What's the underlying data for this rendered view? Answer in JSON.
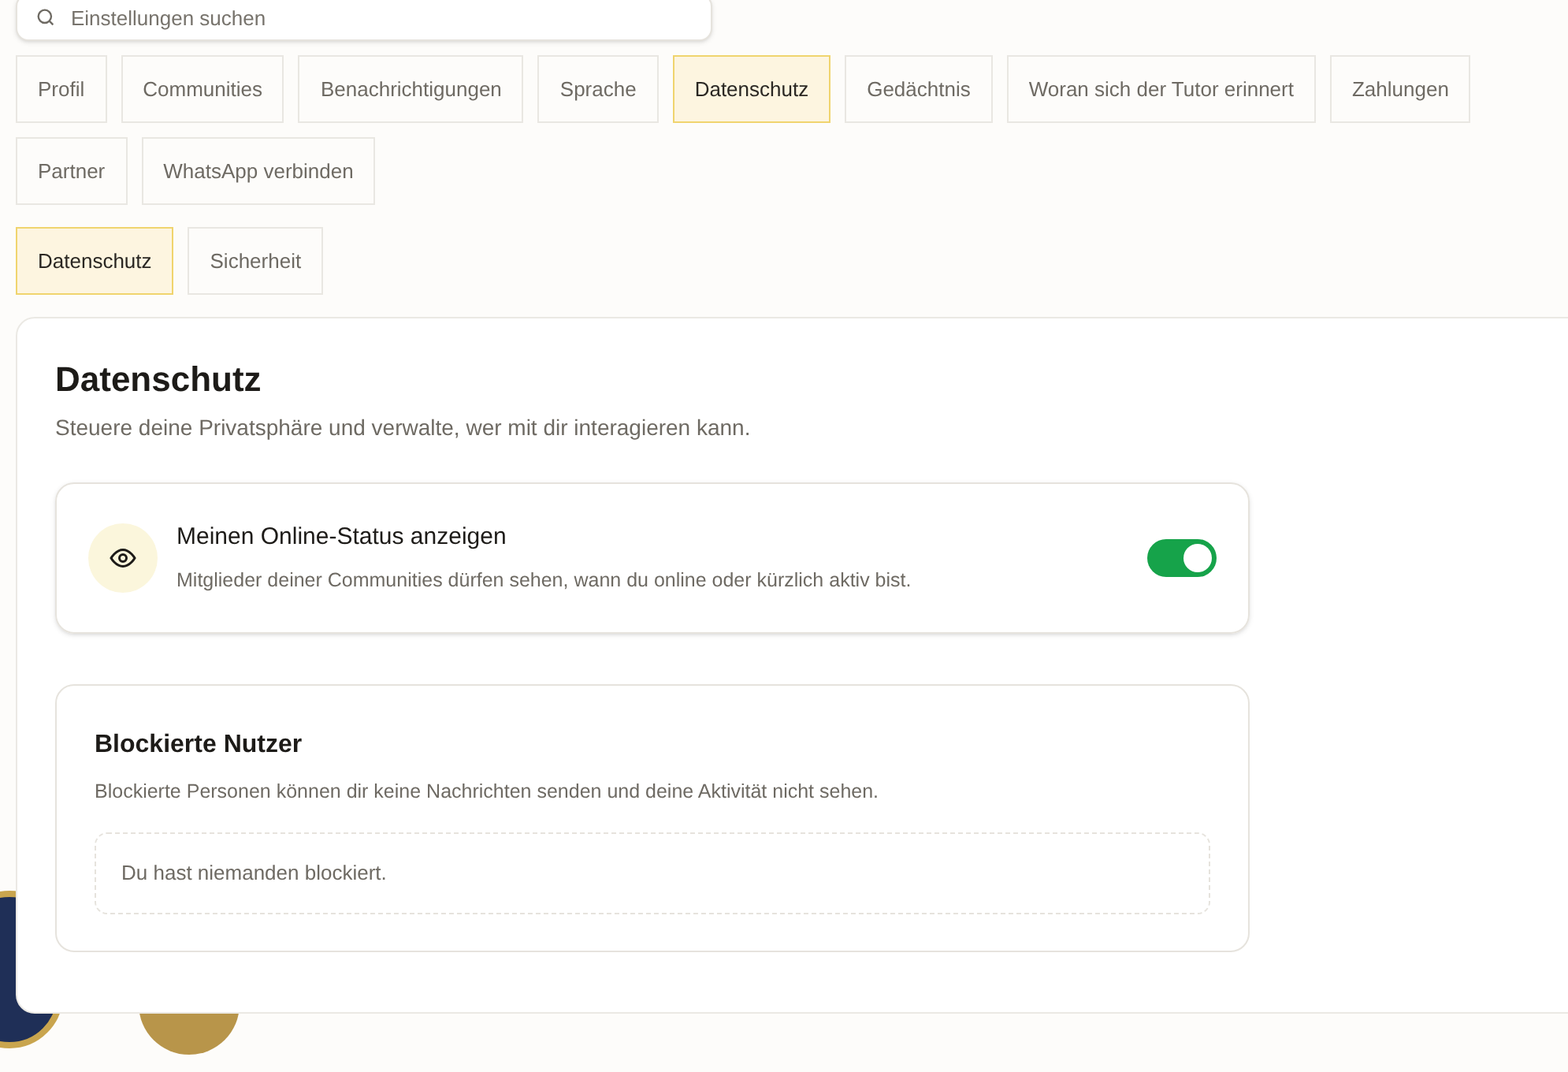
{
  "search": {
    "placeholder": "Einstellungen suchen"
  },
  "tabs": [
    {
      "label": "Profil",
      "selected": false
    },
    {
      "label": "Communities",
      "selected": false
    },
    {
      "label": "Benachrichtigungen",
      "selected": false
    },
    {
      "label": "Sprache",
      "selected": false
    },
    {
      "label": "Datenschutz",
      "selected": true
    },
    {
      "label": "Gedächtnis",
      "selected": false
    },
    {
      "label": "Woran sich der Tutor erinnert",
      "selected": false
    },
    {
      "label": "Zahlungen",
      "selected": false
    },
    {
      "label": "Partner",
      "selected": false
    },
    {
      "label": "WhatsApp verbinden",
      "selected": false
    }
  ],
  "subtabs": [
    {
      "label": "Datenschutz",
      "selected": true
    },
    {
      "label": "Sicherheit",
      "selected": false
    }
  ],
  "panel": {
    "title": "Datenschutz",
    "subtitle": "Steuere deine Privatsphäre und verwalte, wer mit dir interagieren kann.",
    "setting": {
      "title": "Meinen Online-Status anzeigen",
      "description": "Mitglieder deiner Communities dürfen sehen, wann du online oder kürzlich aktiv bist.",
      "on": true
    },
    "blocked": {
      "title": "Blockierte Nutzer",
      "description": "Blockierte Personen können dir keine Nachrichten senden und deine Aktivität nicht sehen.",
      "empty": "Du hast niemanden blockiert."
    }
  }
}
